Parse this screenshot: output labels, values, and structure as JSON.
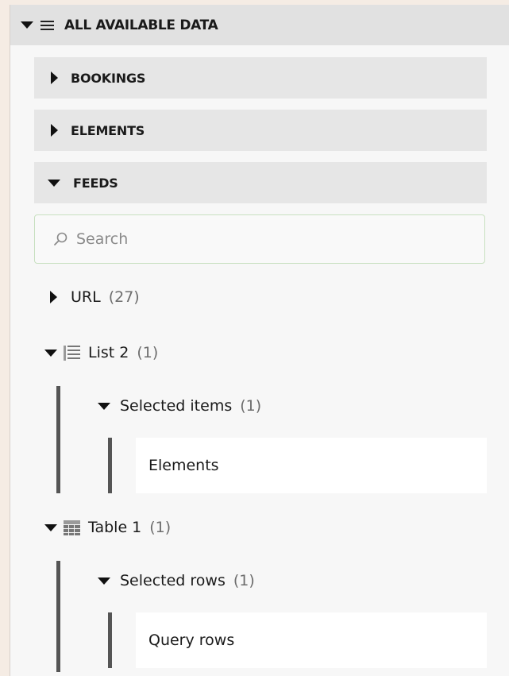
{
  "root": {
    "title": "ALL AVAILABLE DATA",
    "expanded": true
  },
  "sections": [
    {
      "label": "BOOKINGS",
      "expanded": false
    },
    {
      "label": "ELEMENTS",
      "expanded": false
    },
    {
      "label": "FEEDS",
      "expanded": true
    }
  ],
  "search": {
    "placeholder": "Search",
    "value": ""
  },
  "tree": {
    "url": {
      "label": "URL",
      "count": "(27)",
      "expanded": false
    },
    "list2": {
      "label": "List 2",
      "count": "(1)",
      "icon": "list-icon",
      "group": {
        "label": "Selected items",
        "count": "(1)"
      },
      "leaf": "Elements"
    },
    "table1": {
      "label": "Table 1",
      "count": "(1)",
      "icon": "table-icon",
      "group": {
        "label": "Selected rows",
        "count": "(1)"
      },
      "leaf": "Query rows"
    }
  },
  "colors": {
    "page_background": "#f5ece4",
    "panel_background": "#f7f7f7",
    "header_background": "#e1e1e1",
    "section_background": "#e6e6e6",
    "search_border": "#c8e0c0",
    "tree_bar": "#555555"
  }
}
